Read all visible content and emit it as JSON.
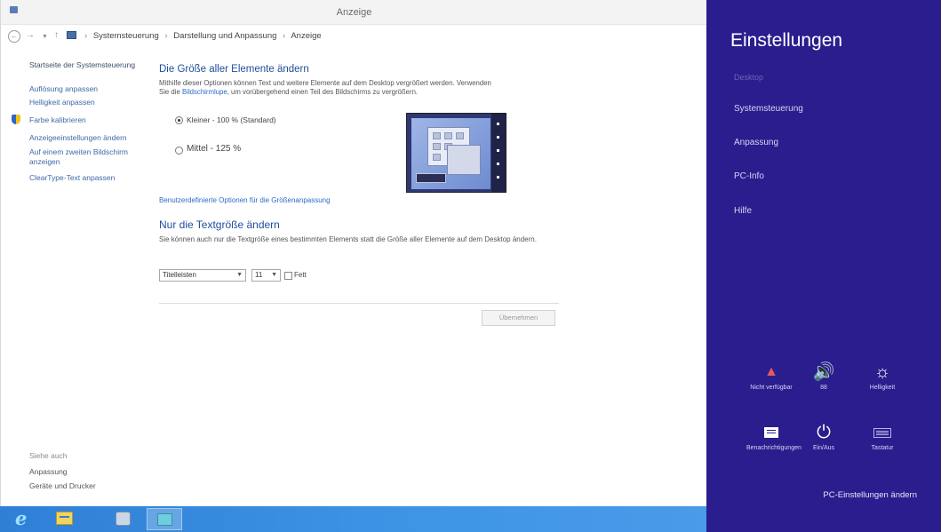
{
  "window": {
    "title": "Anzeige"
  },
  "address_bar": {
    "path": [
      "Systemsteuerung",
      "Darstellung und Anpassung",
      "Anzeige"
    ],
    "separator": "›"
  },
  "left_nav": {
    "home": "Startseite der Systemsteuerung",
    "items": [
      "Auflösung anpassen",
      "Helligkeit anpassen",
      "Farbe kalibrieren",
      "Anzeigeeinstellungen ändern",
      "Auf einem zweiten Bildschirm anzeigen",
      "ClearType-Text anpassen"
    ],
    "see_also_label": "Siehe auch",
    "see_also": [
      "Anpassung",
      "Geräte und Drucker"
    ]
  },
  "main": {
    "size_heading": "Die Größe aller Elemente ändern",
    "size_desc_1": "Mithilfe dieser Optionen können Text und weitere Elemente auf dem Desktop vergrößert werden. Verwenden",
    "size_desc_2": "Sie die",
    "size_desc_link": "Bildschirmlupe",
    "size_desc_3": ", um vorübergehend einen Teil des Bildschirms zu vergrößern.",
    "option_small": "Kleiner - 100 % (Standard)",
    "option_medium": "Mittel - 125 %",
    "selected_option": "small",
    "custom_link": "Benutzerdefinierte Optionen für die Größenanpassung",
    "text_heading": "Nur die Textgröße ändern",
    "text_desc": "Sie können auch nur die Textgröße eines bestimmten Elements statt die Größe aller Elemente auf dem Desktop ändern.",
    "element_select": "Titelleisten",
    "size_select": "11",
    "bold_label": "Fett",
    "bold_checked": false,
    "apply_button": "Übernehmen"
  },
  "taskbar": {
    "items": [
      "internet-explorer",
      "file-explorer",
      "control-panel",
      "app"
    ],
    "color": "#3e95e6"
  },
  "charms": {
    "title": "Einstellungen",
    "context": "Desktop",
    "links": [
      "Systemsteuerung",
      "Anpassung",
      "PC-Info",
      "Hilfe"
    ],
    "quick": {
      "network": "Nicht verfügbar",
      "volume": "88",
      "brightness": "Helligkeit",
      "notifications": "Benachrichtigungen",
      "power": "Ein/Aus",
      "keyboard": "Tastatur"
    },
    "change_pc_settings": "PC-Einstellungen ändern",
    "background": "#2a1d8e"
  }
}
